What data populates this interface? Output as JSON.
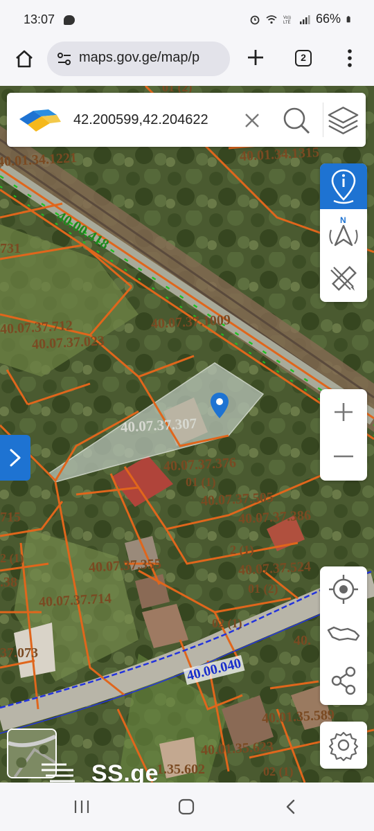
{
  "status_bar": {
    "time": "13:07",
    "network": "VoLTE LTE",
    "battery": "66%"
  },
  "browser": {
    "url": "maps.gov.ge/map/p",
    "tab_count": "2"
  },
  "search": {
    "value": "42.200599,42.204622"
  },
  "map": {
    "parcel_labels": [
      "01 (2)",
      "40.01.34.1221",
      "40.01.34.1315",
      "40.00.418",
      "731",
      "40.07.37.712",
      "40.07.37.023",
      "40.07.37.1009",
      "40.07.37.307",
      "40.07.37.376",
      "01 (1)",
      "40.07.37.505",
      "715",
      "40.07.37.386",
      "2 (1)",
      "2 (1)",
      "40.07.37.355",
      "40.07.37.524",
      ".38",
      "01 (2)",
      "40.07.37.714",
      "02 (1)",
      "37.073",
      "40.",
      "40.00.040",
      "40.01.35.589",
      "40.01.35.623",
      "1.35.602",
      "02 (1)"
    ],
    "colors": {
      "parcel_border": "#e0661c",
      "parcel_label": "#7a4a22",
      "road_label_green": "#1d8a1d",
      "road_label_blue": "#1a2fcc",
      "selection_fill": "#b7c3b7",
      "accent": "#1e73d2"
    }
  },
  "icons": {
    "logo": "napr-logo",
    "clear": "close-icon",
    "search": "search-icon",
    "layers": "layers-icon",
    "info": "info-pin-icon",
    "compass": "north-compass-icon",
    "measure": "ruler-pencil-icon",
    "zoom_in": "plus-icon",
    "zoom_out": "minus-icon",
    "locate": "crosshair-icon",
    "georgia": "georgia-map-icon",
    "share": "share-icon",
    "settings": "gear-icon",
    "expand": "chevron-right-icon"
  },
  "watermark": {
    "text": "SS.ge"
  }
}
